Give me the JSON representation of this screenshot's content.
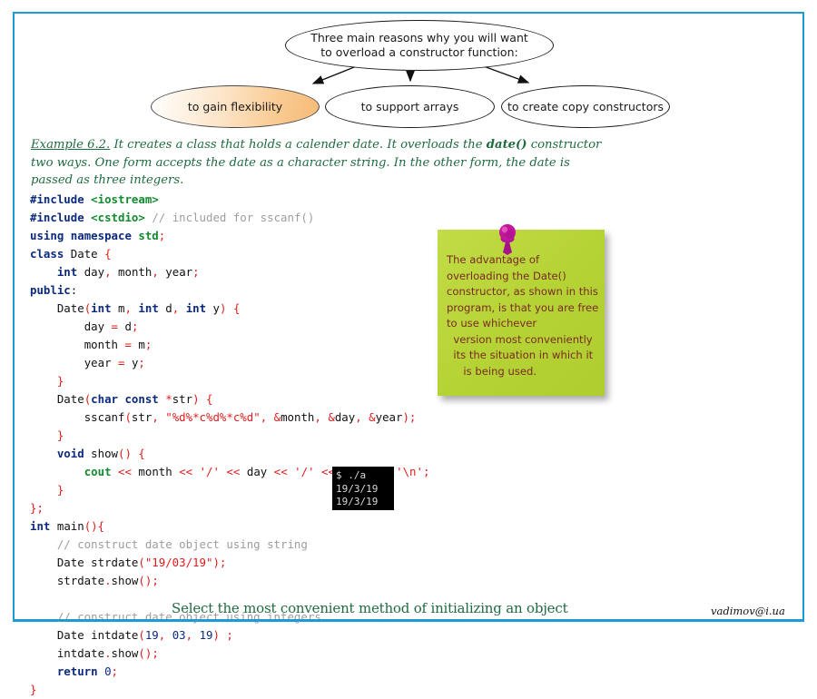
{
  "theme": {
    "frame_color": "#1b9ad8",
    "note_green": "#b7d437",
    "note_text": "#7a2a24",
    "pin_color": "#c2169b",
    "caption_green": "#1f6b41",
    "highlight_orange": "#f6bb78"
  },
  "diagram": {
    "root": {
      "line1": "Three main reasons why you will want",
      "line2": "to overload a constructor function:"
    },
    "options": [
      {
        "label": "to gain flexibility",
        "highlighted": true
      },
      {
        "label": "to support arrays",
        "highlighted": false
      },
      {
        "label": "to create copy constructors",
        "highlighted": false
      }
    ]
  },
  "example": {
    "label": "Example 6.2.",
    "text_before": " It creates a class that holds a calender date. It overloads the ",
    "bold_term": "date()",
    "text_after": " constructor two ways. One form accepts the date as a character string. In the other form, the date is passed as three integers."
  },
  "code": {
    "language": "cpp",
    "lines": [
      "#include <iostream>",
      "#include <cstdio> // included for sscanf()",
      "using namespace std;",
      "class Date {",
      "    int day, month, year;",
      "public:",
      "    Date(int m, int d, int y) {",
      "        day = d;",
      "        month = m;",
      "        year = y;",
      "    }",
      "    Date(char const *str) {",
      "        sscanf(str, \"%d%*c%d%*c%d\", &month, &day, &year);",
      "    }",
      "    void show() {",
      "        cout << month << '/' << day << '/' << year << '\\n';",
      "    }",
      "};",
      "int main(){",
      "    // construct date object using string",
      "    Date strdate(\"19/03/19\");",
      "    strdate.show();",
      "",
      "    // construct date object using integers",
      "    Date intdate(19, 03, 19) ;",
      "    intdate.show();",
      "    return 0;",
      "}"
    ]
  },
  "sticky_note": {
    "lines": [
      "The advantage of",
      "overloading the Date()",
      "constructor, as shown in this",
      "program, is that you are free",
      "to use whichever",
      "  version most conveniently",
      "  its the situation in which it",
      "     is being used."
    ]
  },
  "terminal": {
    "lines": [
      "$ ./a",
      "19/3/19",
      "19/3/19"
    ]
  },
  "footer": {
    "title": "Select the most convenient method of initializing an object",
    "email": "vadimov@i.ua"
  }
}
